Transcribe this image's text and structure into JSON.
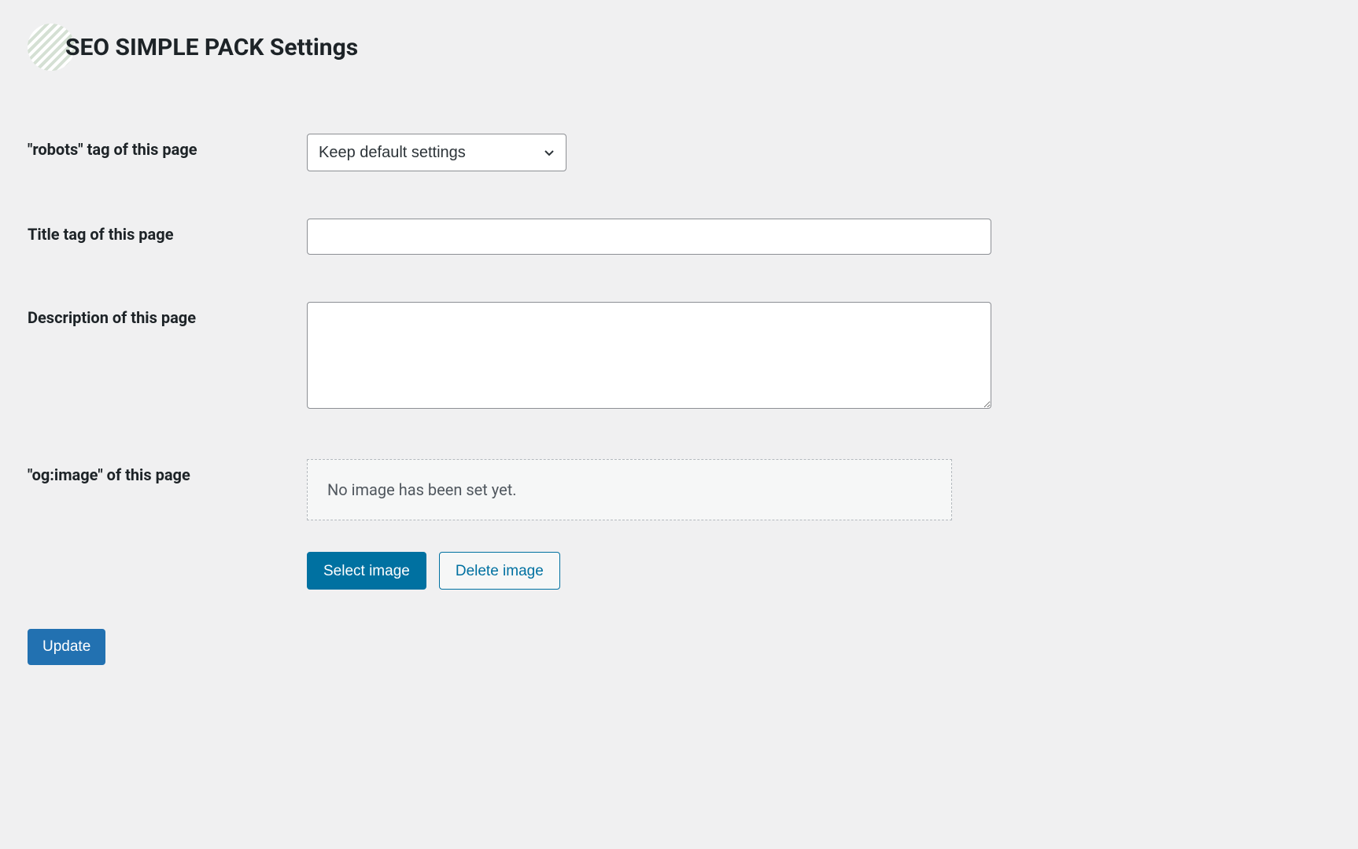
{
  "header": {
    "title": "SEO SIMPLE PACK Settings"
  },
  "fields": {
    "robots": {
      "label": "\"robots\" tag of this page",
      "selected": "Keep default settings"
    },
    "title": {
      "label": "Title tag of this page",
      "value": ""
    },
    "description": {
      "label": "Description of this page",
      "value": ""
    },
    "ogimage": {
      "label": "\"og:image\" of this page",
      "placeholder_text": "No image has been set yet.",
      "select_button": "Select image",
      "delete_button": "Delete image"
    }
  },
  "actions": {
    "update": "Update"
  }
}
